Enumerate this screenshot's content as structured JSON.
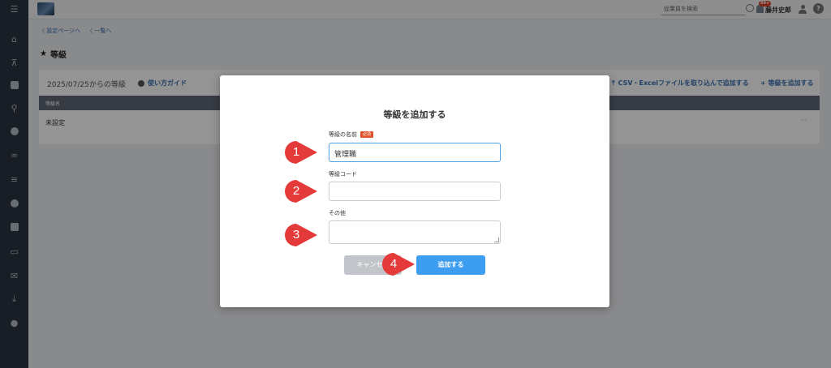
{
  "topbar": {
    "search_placeholder": "従業員を検索",
    "badge": "99+",
    "username": "藤井史郎",
    "help_label": "?"
  },
  "sidebar": {
    "icons": [
      "home-icon",
      "org-chart-icon",
      "document-icon",
      "search-icon",
      "chat-icon",
      "link-icon",
      "chart-icon",
      "globe-icon",
      "contact-card-icon",
      "book-icon",
      "mail-icon",
      "download-icon",
      "user-settings-icon"
    ]
  },
  "breadcrumb": {
    "back_to_settings": "〈 設定ページへ",
    "back_to_list": "〈 一覧へ"
  },
  "page": {
    "star": "★",
    "title": "等級",
    "period": "2025/07/25からの等級",
    "guide": "使い方ガイド",
    "csv_import": "CSV・Excelファイルを取り込んで追加する",
    "add_grade": "+ 等級を追加する",
    "table_header": "等級名",
    "table_rows": [
      "未設定"
    ],
    "row_menu": "···"
  },
  "modal": {
    "title": "等級を追加する",
    "name_label": "等級の名前",
    "required_badge": "必須",
    "name_value": "管理職",
    "code_label": "等級コード",
    "code_value": "",
    "other_label": "その他",
    "other_value": "",
    "cancel_label": "キャンセル",
    "submit_label": "追加する"
  },
  "markers": [
    "1",
    "2",
    "3",
    "4"
  ],
  "colors": {
    "marker": "#e53a3a",
    "primary": "#3d9df0",
    "required": "#e0522b",
    "link": "#3a6fb0"
  }
}
